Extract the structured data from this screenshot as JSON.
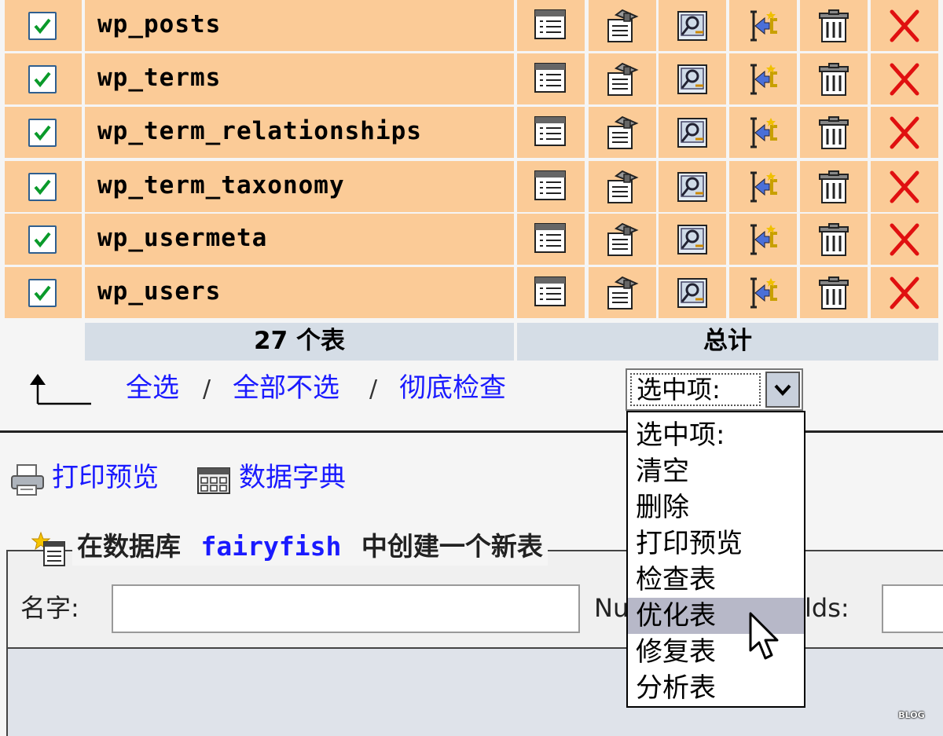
{
  "tables": [
    {
      "name": "wp_posts",
      "checked": true
    },
    {
      "name": "wp_terms",
      "checked": true
    },
    {
      "name": "wp_term_relationships",
      "checked": true
    },
    {
      "name": "wp_term_taxonomy",
      "checked": true
    },
    {
      "name": "wp_usermeta",
      "checked": true
    },
    {
      "name": "wp_users",
      "checked": true
    }
  ],
  "row_icons": [
    "browse-icon",
    "structure-icon",
    "search-icon",
    "insert-icon",
    "empty-icon",
    "drop-icon"
  ],
  "summary": {
    "table_count": "27 个表",
    "total": "总计"
  },
  "selection_links": {
    "select_all": "全选",
    "sep1": "/",
    "select_none": "全部不选",
    "sep2": "/",
    "check_overhead": "彻底检查"
  },
  "with_selected": {
    "value": "选中项:",
    "options": [
      "选中项:",
      "清空",
      "删除",
      "打印预览",
      "检查表",
      "优化表",
      "修复表",
      "分析表"
    ],
    "highlighted": "优化表"
  },
  "tools": {
    "print_view": "打印预览",
    "data_dictionary": "数据字典"
  },
  "create_table": {
    "legend_prefix": "在数据库",
    "db_name": "fairyfish",
    "legend_suffix": "中创建一个新表",
    "name_label": "名字:",
    "fields_label_left": "Nu",
    "fields_label_right": "lds:"
  },
  "watermark": "BLOG",
  "colors": {
    "row_bg": "#fbcb97",
    "footer_bg": "#d5dde6",
    "link": "#1a1aff",
    "highlight": "#b7b8c8"
  }
}
